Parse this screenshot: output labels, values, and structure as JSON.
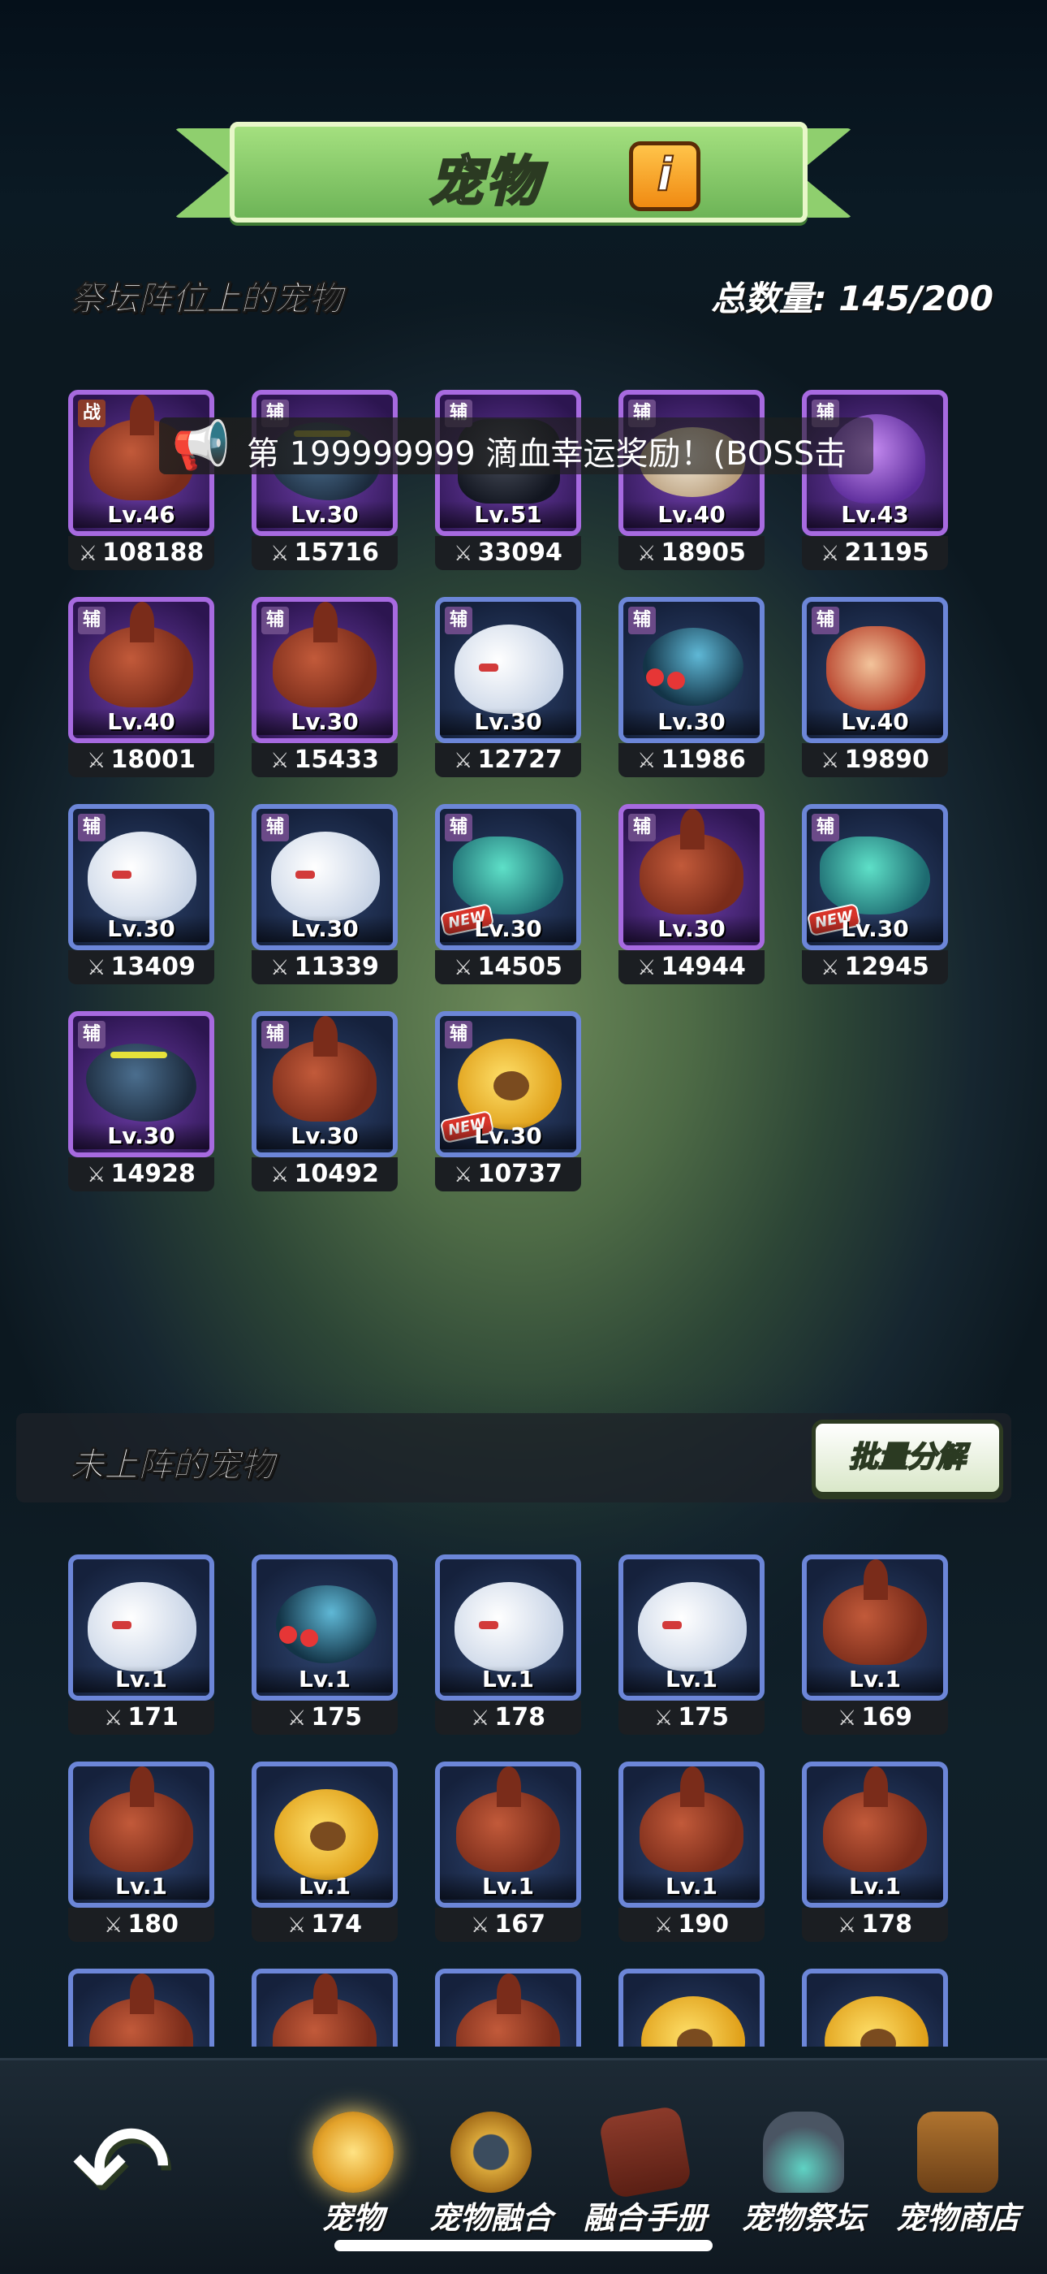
{
  "header": {
    "title": "宠物",
    "info_label": "i"
  },
  "placed_section": {
    "label": "祭坛阵位上的宠物",
    "total_label": "总数量: 145/200",
    "pets": [
      {
        "badge": "战",
        "badge_type": "war",
        "level": "Lv.46",
        "power": "108188",
        "monster": "scorp",
        "frame": "purple"
      },
      {
        "badge": "辅",
        "badge_type": "sup",
        "level": "Lv.30",
        "power": "15716",
        "monster": "dragon",
        "frame": "purple"
      },
      {
        "badge": "辅",
        "badge_type": "sup",
        "level": "Lv.51",
        "power": "33094",
        "monster": "knight",
        "frame": "purple"
      },
      {
        "badge": "辅",
        "badge_type": "sup",
        "level": "Lv.40",
        "power": "18905",
        "monster": "goat",
        "frame": "purple"
      },
      {
        "badge": "辅",
        "badge_type": "sup",
        "level": "Lv.43",
        "power": "21195",
        "monster": "octo",
        "frame": "purple"
      },
      {
        "badge": "辅",
        "badge_type": "sup",
        "level": "Lv.40",
        "power": "18001",
        "monster": "scorp",
        "frame": "purple"
      },
      {
        "badge": "辅",
        "badge_type": "sup",
        "level": "Lv.30",
        "power": "15433",
        "monster": "scorp",
        "frame": "purple"
      },
      {
        "badge": "辅",
        "badge_type": "sup",
        "level": "Lv.30",
        "power": "12727",
        "monster": "bear",
        "frame": "blue"
      },
      {
        "badge": "辅",
        "badge_type": "sup",
        "level": "Lv.30",
        "power": "11986",
        "monster": "spider",
        "frame": "blue"
      },
      {
        "badge": "辅",
        "badge_type": "sup",
        "level": "Lv.40",
        "power": "19890",
        "monster": "dwarf",
        "frame": "blue"
      },
      {
        "badge": "辅",
        "badge_type": "sup",
        "level": "Lv.30",
        "power": "13409",
        "monster": "bear",
        "frame": "blue"
      },
      {
        "badge": "辅",
        "badge_type": "sup",
        "level": "Lv.30",
        "power": "11339",
        "monster": "bear",
        "frame": "blue"
      },
      {
        "badge": "辅",
        "badge_type": "sup",
        "level": "Lv.30",
        "power": "14505",
        "monster": "lizard",
        "frame": "blue",
        "new": "NEW"
      },
      {
        "badge": "辅",
        "badge_type": "sup",
        "level": "Lv.30",
        "power": "14944",
        "monster": "scorp",
        "frame": "purple"
      },
      {
        "badge": "辅",
        "badge_type": "sup",
        "level": "Lv.30",
        "power": "12945",
        "monster": "lizard",
        "frame": "blue",
        "new": "NEW"
      },
      {
        "badge": "辅",
        "badge_type": "sup",
        "level": "Lv.30",
        "power": "14928",
        "monster": "dragon",
        "frame": "purple"
      },
      {
        "badge": "辅",
        "badge_type": "sup",
        "level": "Lv.30",
        "power": "10492",
        "monster": "scorp",
        "frame": "blue"
      },
      {
        "badge": "辅",
        "badge_type": "sup",
        "level": "Lv.30",
        "power": "10737",
        "monster": "bee",
        "frame": "blue",
        "new": "NEW"
      }
    ]
  },
  "toast": {
    "text": "第 199999999 滴血幸运奖励！(BOSS击"
  },
  "unplaced_section": {
    "label": "未上阵的宠物",
    "batch_button": "批量分解",
    "pets": [
      {
        "level": "Lv.1",
        "power": "171",
        "monster": "bear"
      },
      {
        "level": "Lv.1",
        "power": "175",
        "monster": "spider"
      },
      {
        "level": "Lv.1",
        "power": "178",
        "monster": "bear"
      },
      {
        "level": "Lv.1",
        "power": "175",
        "monster": "bear"
      },
      {
        "level": "Lv.1",
        "power": "169",
        "monster": "scorp"
      },
      {
        "level": "Lv.1",
        "power": "180",
        "monster": "scorp"
      },
      {
        "level": "Lv.1",
        "power": "174",
        "monster": "bee"
      },
      {
        "level": "Lv.1",
        "power": "167",
        "monster": "scorp"
      },
      {
        "level": "Lv.1",
        "power": "190",
        "monster": "scorp"
      },
      {
        "level": "Lv.1",
        "power": "178",
        "monster": "scorp"
      },
      {
        "level": "",
        "power": "",
        "monster": "scorp"
      },
      {
        "level": "",
        "power": "",
        "monster": "scorp"
      },
      {
        "level": "",
        "power": "",
        "monster": "scorp"
      },
      {
        "level": "",
        "power": "",
        "monster": "bee"
      },
      {
        "level": "",
        "power": "",
        "monster": "bee"
      }
    ]
  },
  "nav": {
    "back_icon": "back-arrow-icon",
    "items": [
      {
        "label": "宠物",
        "icon": "pet-coin-icon",
        "active": true
      },
      {
        "label": "宠物融合",
        "icon": "fusion-icon",
        "active": false
      },
      {
        "label": "融合手册",
        "icon": "handbook-icon",
        "active": false
      },
      {
        "label": "宠物祭坛",
        "icon": "altar-icon",
        "active": false
      },
      {
        "label": "宠物商店",
        "icon": "shop-icon",
        "active": false
      }
    ]
  }
}
